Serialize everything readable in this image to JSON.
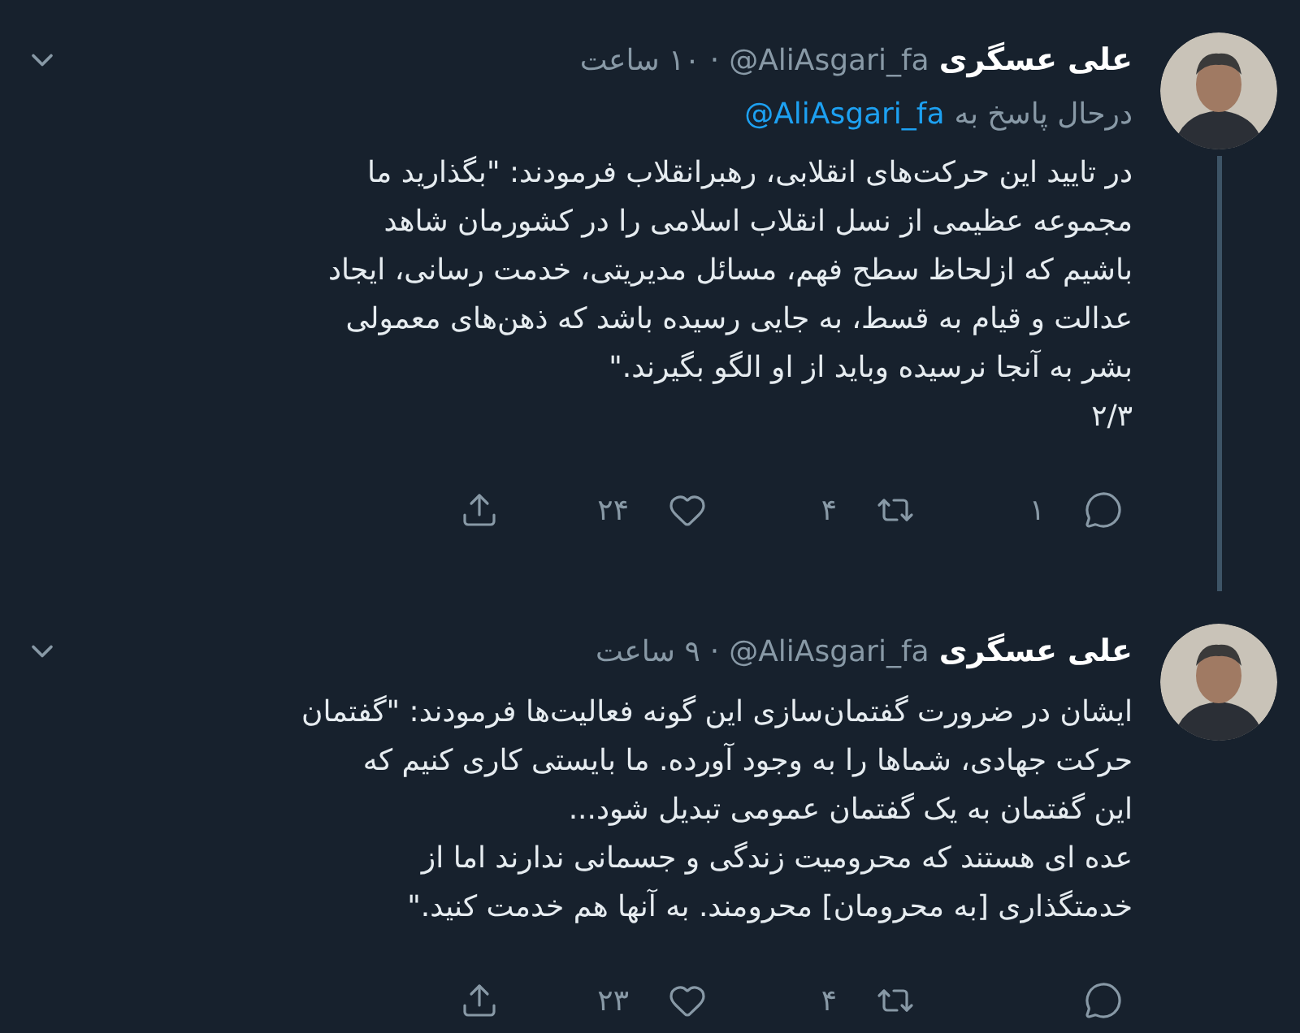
{
  "tweets": [
    {
      "name": "علی عسگری",
      "handle": "@AliAsgari_fa",
      "separator": "·",
      "time": "۱۰ ساعت",
      "reply_to": {
        "label": "درحال پاسخ به",
        "handle": "@AliAsgari_fa"
      },
      "thread_connected": true,
      "body": "در تایید این حرکت‌های انقلابی، رهبرانقلاب فرمودند: \"بگذارید ما\nمجموعه عظیمی از نسل انقلاب اسلامی را در کشورمان شاهد\nباشیم که ازلحاظ سطح فهم، مسائل مدیریتی، خدمت رسانی، ایجاد\nعدالت و قیام به قسط، به جایی رسیده باشد که ذهن‌های معمولی\nبشر به آنجا نرسیده وباید از او الگو بگیرند.\"\n۲/۳",
      "actions": [
        {
          "kind": "reply",
          "count": "۱"
        },
        {
          "kind": "retweet",
          "count": "۴"
        },
        {
          "kind": "like",
          "count": "۲۴"
        },
        {
          "kind": "share"
        }
      ]
    },
    {
      "name": "علی عسگری",
      "handle": "@AliAsgari_fa",
      "separator": "·",
      "time": "۹ ساعت",
      "thread_connected": false,
      "body": "ایشان در ضرورت گفتمان‌سازی این گونه فعالیت‌ها فرمودند: \"گفتمان\nحرکت جهادی، شماها را به وجود آورده. ما بایستی کاری کنیم که\nاین گفتمان به یک گفتمان عمومی تبدیل شود...\n عده ای هستند که محرومیت زندگی و جسمانی ندارند اما از\nخدمتگذاری [به محرومان] محرومند. به آنها هم خدمت کنید.\"",
      "actions": [
        {
          "kind": "reply"
        },
        {
          "kind": "retweet",
          "count": "۴"
        },
        {
          "kind": "like",
          "count": "۲۳"
        },
        {
          "kind": "share"
        }
      ]
    }
  ]
}
